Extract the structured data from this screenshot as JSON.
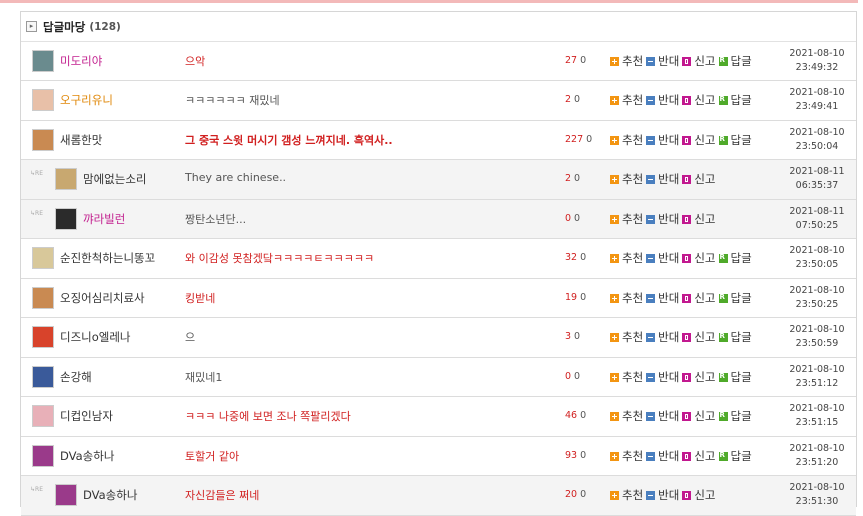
{
  "board": {
    "title": "답글마당",
    "count": "(128)"
  },
  "labels": {
    "recommend": "추천",
    "oppose": "반대",
    "report": "신고",
    "reply": "답글",
    "reply_marker": "↳RE"
  },
  "comments": [
    {
      "name": "미도리야",
      "name_color": "#c21f8e",
      "text": "으악",
      "text_style": "red",
      "up": "27",
      "down": "0",
      "date": "2021-08-10",
      "time": "23:49:32",
      "is_reply": false,
      "avatar_color": "#6a8b8e"
    },
    {
      "name": "오구리유니",
      "name_color": "#e0880a",
      "text": "ㅋㅋㅋㅋㅋㅋ 재밌네",
      "text_style": "gray",
      "up": "2",
      "down": "0",
      "date": "2021-08-10",
      "time": "23:49:41",
      "is_reply": false,
      "avatar_color": "#e8c0a8"
    },
    {
      "name": "새롬한맛",
      "name_color": "#333333",
      "text": "그 중국 스윗 머시기 갬성 느껴지네. 흑역사..",
      "text_style": "red-bold",
      "up": "227",
      "down": "0",
      "date": "2021-08-10",
      "time": "23:50:04",
      "is_reply": false,
      "avatar_color": "#c98a52"
    },
    {
      "name": "맘에없는소리",
      "name_color": "#333333",
      "text": "They are chinese..",
      "text_style": "gray",
      "up": "2",
      "down": "0",
      "date": "2021-08-11",
      "time": "06:35:37",
      "is_reply": true,
      "avatar_color": "#c8a870"
    },
    {
      "name": "꺄라빌런",
      "name_color": "#c21f8e",
      "text": "짱탄소년단...",
      "text_style": "gray",
      "up": "0",
      "down": "0",
      "date": "2021-08-11",
      "time": "07:50:25",
      "is_reply": true,
      "avatar_color": "#2b2b2b"
    },
    {
      "name": "순진한척하는니똥꼬",
      "name_color": "#333333",
      "text": "와 이감성 못참겠닼ㅋㅋㅋㅋㅌㅋㅋㅋㅋㅋ",
      "text_style": "red",
      "up": "32",
      "down": "0",
      "date": "2021-08-10",
      "time": "23:50:05",
      "is_reply": false,
      "avatar_color": "#d8c89a"
    },
    {
      "name": "오징어심리치료사",
      "name_color": "#333333",
      "text": "킹받네",
      "text_style": "red",
      "up": "19",
      "down": "0",
      "date": "2021-08-10",
      "time": "23:50:25",
      "is_reply": false,
      "avatar_color": "#c98a52"
    },
    {
      "name": "디즈니o엘레나",
      "name_color": "#333333",
      "text": "으",
      "text_style": "gray",
      "up": "3",
      "down": "0",
      "date": "2021-08-10",
      "time": "23:50:59",
      "is_reply": false,
      "avatar_color": "#d8432b"
    },
    {
      "name": "손강해",
      "name_color": "#333333",
      "text": "재밌네1",
      "text_style": "gray",
      "up": "0",
      "down": "0",
      "date": "2021-08-10",
      "time": "23:51:12",
      "is_reply": false,
      "avatar_color": "#3a5a9a"
    },
    {
      "name": "디컵인남자",
      "name_color": "#333333",
      "text": "ㅋㅋㅋ 나중에 보면 조나 쪽팔리겠다",
      "text_style": "red",
      "up": "46",
      "down": "0",
      "date": "2021-08-10",
      "time": "23:51:15",
      "is_reply": false,
      "avatar_color": "#e8b0b8"
    },
    {
      "name": "DVa송하나",
      "name_color": "#333333",
      "text": "토할거 같아",
      "text_style": "red",
      "up": "93",
      "down": "0",
      "date": "2021-08-10",
      "time": "23:51:20",
      "is_reply": false,
      "avatar_color": "#9a3a8a"
    },
    {
      "name": "DVa송하나",
      "name_color": "#333333",
      "text": "자신감들은 쩌네",
      "text_style": "red",
      "up": "20",
      "down": "0",
      "date": "2021-08-10",
      "time": "23:51:30",
      "is_reply": true,
      "avatar_color": "#9a3a8a"
    }
  ],
  "colors": {
    "up_count": "#d12020",
    "recommend_icon": "#f39512",
    "oppose_icon": "#4a7fbf",
    "report_icon": "#c2188f",
    "reply_icon": "#4faa2a"
  }
}
